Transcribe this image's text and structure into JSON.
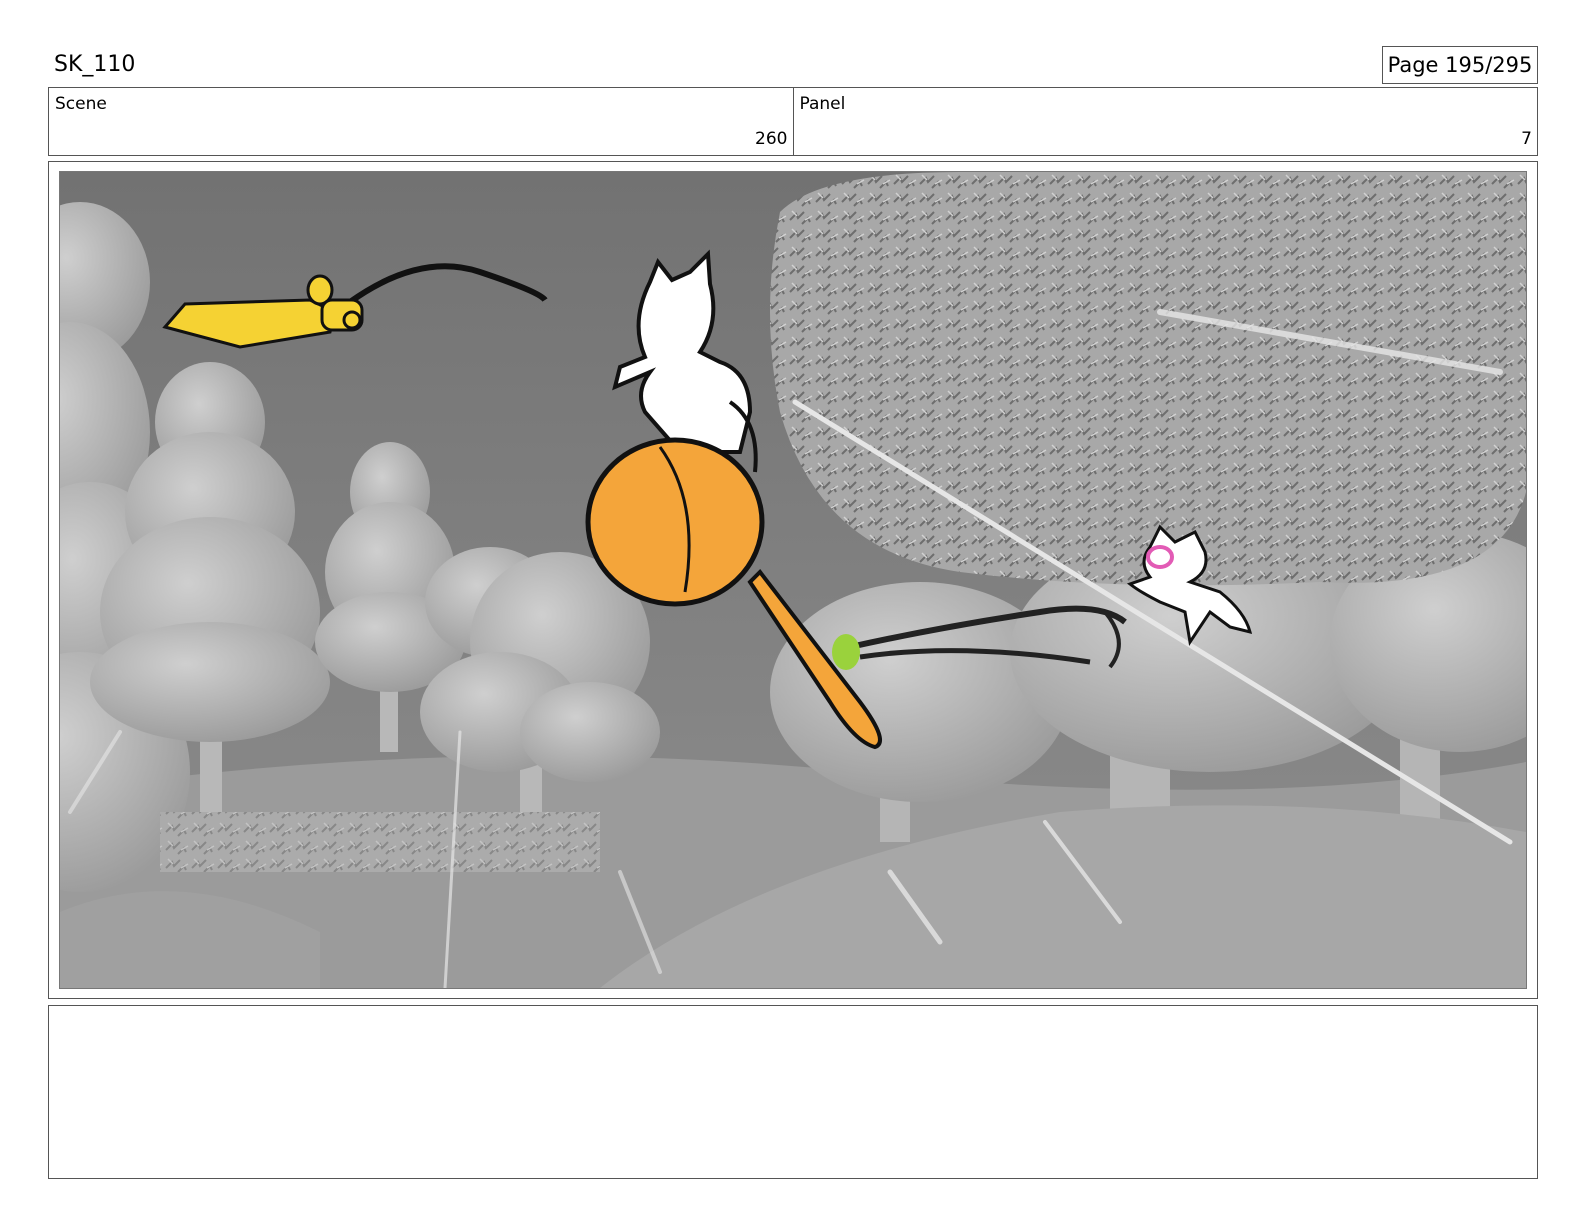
{
  "header": {
    "project": "SK_110",
    "page_label": "Page 195/295"
  },
  "scene": {
    "label": "Scene",
    "value": "260"
  },
  "panel": {
    "label": "Panel",
    "value": "7"
  },
  "notes": {
    "text": ""
  },
  "colors": {
    "sky": "#7c7c7c",
    "foliage": "#b4b4b4",
    "ground": "#a9a9a9",
    "ball_orange": "#f4a53a",
    "sword_yellow": "#f5d233",
    "tongue_green": "#9ad23c",
    "cheek_pink": "#e25bb5"
  }
}
